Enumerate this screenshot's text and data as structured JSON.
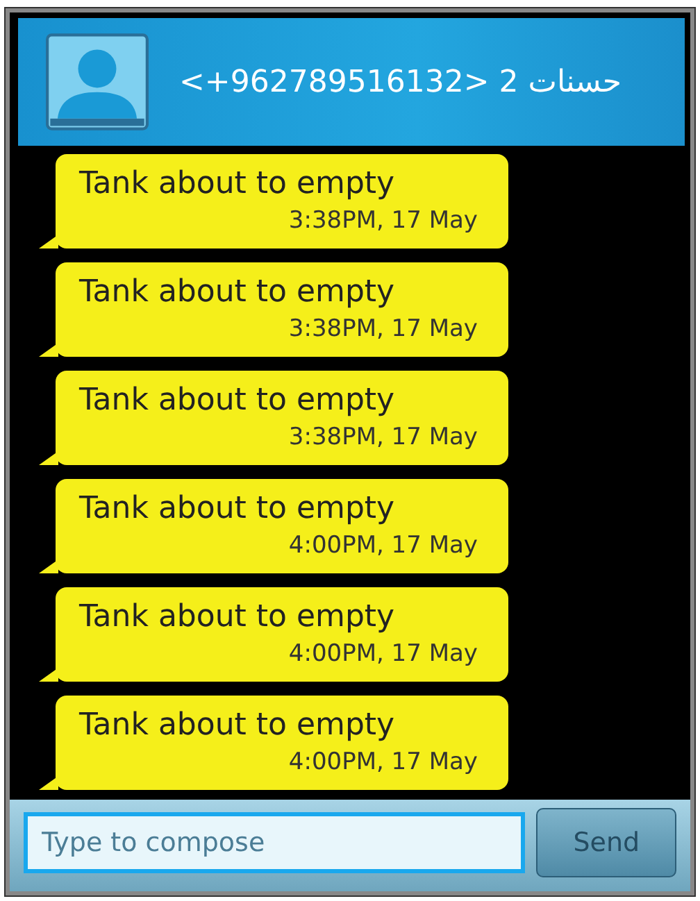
{
  "header": {
    "title": "<+962789516132> 2 حسنات"
  },
  "messages": [
    {
      "text": "Tank about to empty",
      "time": "3:38PM, 17 May"
    },
    {
      "text": "Tank about to empty",
      "time": "3:38PM, 17 May"
    },
    {
      "text": "Tank about to empty",
      "time": "3:38PM, 17 May"
    },
    {
      "text": "Tank about to empty",
      "time": "4:00PM, 17 May"
    },
    {
      "text": "Tank about to empty",
      "time": "4:00PM, 17 May"
    },
    {
      "text": "Tank about to empty",
      "time": "4:00PM, 17 May"
    }
  ],
  "composer": {
    "placeholder": "Type to compose",
    "send": "Send"
  }
}
